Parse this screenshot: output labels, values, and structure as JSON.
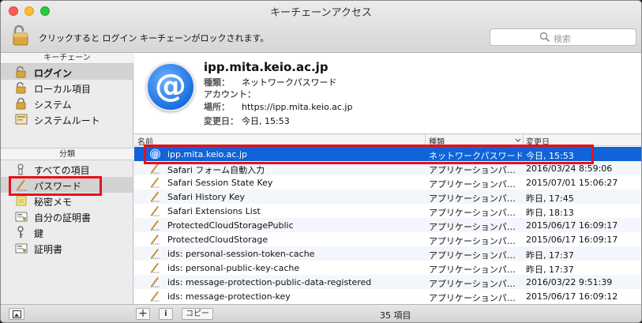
{
  "window": {
    "title": "キーチェーンアクセス"
  },
  "toolbar": {
    "lock_message": "クリックすると ログイン キーチェーンがロックされます。",
    "search_placeholder": "検索"
  },
  "sidebar": {
    "keychains_header": "キーチェーン",
    "keychains": [
      {
        "label": "ログイン",
        "icon": "unlocked-lock-icon",
        "selected": true
      },
      {
        "label": "ローカル項目",
        "icon": "unlocked-lock-icon"
      },
      {
        "label": "システム",
        "icon": "lock-icon"
      },
      {
        "label": "システムルート",
        "icon": "certificate-folder-icon"
      }
    ],
    "categories_header": "分類",
    "categories": [
      {
        "label": "すべての項目",
        "icon": "people-icon"
      },
      {
        "label": "パスワード",
        "icon": "pencil-key-icon",
        "selected": true
      },
      {
        "label": "秘密メモ",
        "icon": "note-icon"
      },
      {
        "label": "自分の証明書",
        "icon": "certificate-icon"
      },
      {
        "label": "鍵",
        "icon": "key-icon"
      },
      {
        "label": "証明書",
        "icon": "certificate-icon"
      }
    ]
  },
  "detail": {
    "name": "ipp.mita.keio.ac.jp",
    "kind_label": "種類：",
    "kind": "ネットワークパスワード",
    "account_label": "アカウント：",
    "account": "",
    "where_label": "場所：",
    "where": "https://ipp.mita.keio.ac.jp",
    "modified_label": "変更日：",
    "modified": "今日, 15:53"
  },
  "table": {
    "columns": {
      "name": "名前",
      "kind": "種類",
      "date": "変更日"
    },
    "rows": [
      {
        "name": "ipp.mita.keio.ac.jp",
        "kind": "ネットワークパスワード",
        "date": "今日, 15:53",
        "icon": "at-icon",
        "selected": true
      },
      {
        "name": "Safari フォーム自動入力",
        "kind": "アプリケーションパ…",
        "date": "2016/03/24 8:59:06",
        "icon": "pencil-key-icon"
      },
      {
        "name": "Safari Session State Key",
        "kind": "アプリケーションパ…",
        "date": "2015/07/01 15:06:27",
        "icon": "pencil-key-icon"
      },
      {
        "name": "Safari History Key",
        "kind": "アプリケーションパ…",
        "date": "昨日, 17:45",
        "icon": "pencil-key-icon"
      },
      {
        "name": "Safari Extensions List",
        "kind": "アプリケーションパ…",
        "date": "昨日, 18:13",
        "icon": "pencil-key-icon"
      },
      {
        "name": "ProtectedCloudStoragePublic",
        "kind": "アプリケーションパ…",
        "date": "2015/06/17 16:09:17",
        "icon": "pencil-key-icon"
      },
      {
        "name": "ProtectedCloudStorage",
        "kind": "アプリケーションパ…",
        "date": "2015/06/17 16:09:17",
        "icon": "pencil-key-icon"
      },
      {
        "name": "ids: personal-session-token-cache",
        "kind": "アプリケーションパ…",
        "date": "昨日, 17:37",
        "icon": "pencil-key-icon"
      },
      {
        "name": "ids: personal-public-key-cache",
        "kind": "アプリケーションパ…",
        "date": "昨日, 17:37",
        "icon": "pencil-key-icon"
      },
      {
        "name": "ids: message-protection-public-data-registered",
        "kind": "アプリケーションパ…",
        "date": "2016/03/22 9:51:39",
        "icon": "pencil-key-icon"
      },
      {
        "name": "ids: message-protection-key",
        "kind": "アプリケーションパ…",
        "date": "2015/06/17 16:09:12",
        "icon": "pencil-key-icon"
      }
    ]
  },
  "bottombar": {
    "add": "+",
    "info": "i",
    "copy": "コピー",
    "count": "35 項目"
  },
  "colors": {
    "selection": "#1063d8",
    "highlight": "#e8101a"
  }
}
